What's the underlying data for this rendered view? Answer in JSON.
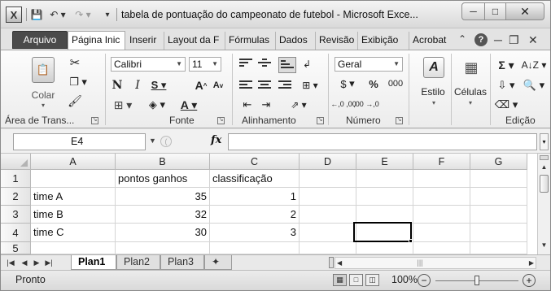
{
  "window": {
    "title": "tabela de pontuação do campeonato de futebol  -  Microsoft Exce...",
    "app_icon": "excel-icon",
    "icons": {
      "save": "save-icon",
      "undo": "undo-icon",
      "redo": "redo-icon",
      "minimize": "minimize-icon",
      "maximize": "maximize-icon",
      "close": "close-icon"
    }
  },
  "ribbon_tabs": {
    "arquivo": "Arquivo",
    "pagina_inicial": "Página Inic",
    "inserir": "Inserir",
    "layout": "Layout da F",
    "formulas": "Fórmulas",
    "dados": "Dados",
    "revisao": "Revisão",
    "exibicao": "Exibição",
    "acrobat": "Acrobat"
  },
  "ribbon": {
    "clipboard": {
      "paste_label": "Colar",
      "group_label": "Área de Trans..."
    },
    "font": {
      "font_name": "Calibri",
      "font_size": "11",
      "group_label": "Fonte"
    },
    "alignment": {
      "group_label": "Alinhamento"
    },
    "number": {
      "format": "Geral",
      "currency_symbol": "$",
      "percent_symbol": "%",
      "thousands_label": "000",
      "inc_decimal": "←,0 ,00",
      "dec_decimal": ",00 →,0",
      "group_label": "Número"
    },
    "styles": {
      "label": "Estilo"
    },
    "cells": {
      "label": "Células"
    },
    "editing": {
      "group_label": "Edição"
    }
  },
  "formula_bar": {
    "name_box": "E4",
    "fx_label": "fx",
    "formula": ""
  },
  "grid": {
    "columns": [
      "A",
      "B",
      "C",
      "D",
      "E",
      "F",
      "G"
    ],
    "row_numbers": [
      "1",
      "2",
      "3",
      "4",
      "5"
    ],
    "rows": [
      [
        "",
        "pontos ganhos",
        "classificação",
        "",
        "",
        "",
        ""
      ],
      [
        "time A",
        "35",
        "1",
        "",
        "",
        "",
        ""
      ],
      [
        "time B",
        "32",
        "2",
        "",
        "",
        "",
        ""
      ],
      [
        "time C",
        "30",
        "3",
        "",
        "",
        "",
        ""
      ],
      [
        "",
        "",
        "",
        "",
        "",
        "",
        ""
      ]
    ],
    "active_cell": "E4"
  },
  "sheets": {
    "tabs": [
      "Plan1",
      "Plan2",
      "Plan3"
    ],
    "active": "Plan1"
  },
  "status": {
    "text": "Pronto",
    "zoom": "100%",
    "zoom_fraction": 0.5
  }
}
